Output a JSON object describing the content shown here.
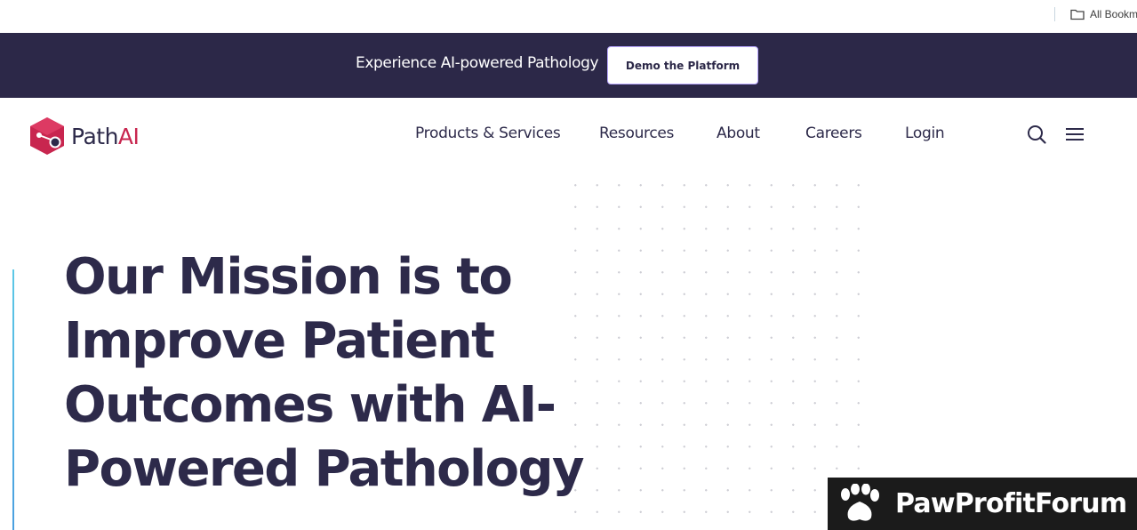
{
  "browser": {
    "bookmarks_label": "All Bookm",
    "icons": {
      "bookmarks": "folder-icon"
    }
  },
  "promo": {
    "text": "Experience AI-powered Pathology",
    "button_label": "Demo the Platform"
  },
  "header": {
    "logo": {
      "path": "Path",
      "ai": "AI"
    },
    "nav": [
      "Products & Services",
      "Resources",
      "About",
      "Careers",
      "Login"
    ],
    "icons": {
      "search": "search-icon",
      "menu": "hamburger-menu-icon"
    }
  },
  "hero": {
    "title": "Our Mission is to Improve Patient Outcomes with AI-Powered Pathology"
  },
  "watermark": {
    "text": "PawProfitForum",
    "icon": "paw-icon"
  },
  "colors": {
    "brand_dark": "#2c2848",
    "brand_red": "#c8264f",
    "accent_line": "#5cc8e6",
    "button_border": "#b9a7ff"
  }
}
